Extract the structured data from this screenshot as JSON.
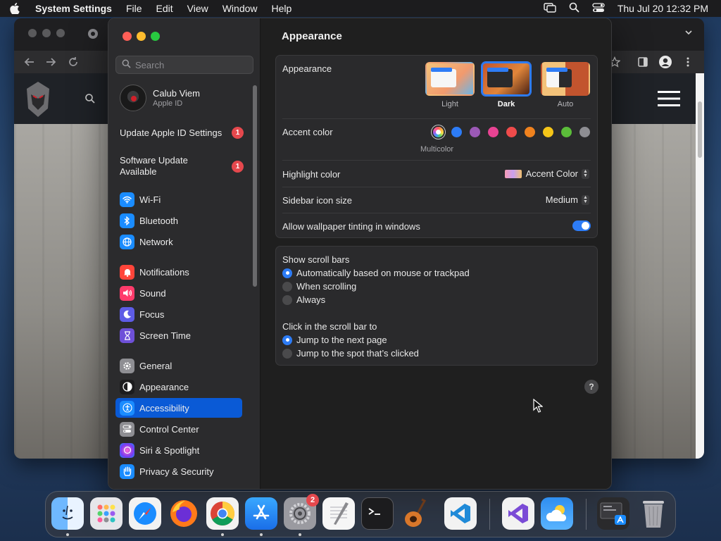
{
  "menubar": {
    "app_name": "System Settings",
    "menus": [
      "File",
      "Edit",
      "View",
      "Window",
      "Help"
    ],
    "clock": "Thu Jul 20  12:32 PM"
  },
  "sidebar": {
    "search_placeholder": "Search",
    "profile": {
      "name": "Calub Viem",
      "subtitle": "Apple ID"
    },
    "notices": [
      {
        "text": "Update Apple ID Settings",
        "badge": "1"
      },
      {
        "text": "Software Update Available",
        "badge": "1"
      }
    ],
    "groups": [
      [
        {
          "label": "Wi-Fi",
          "icon": "wifi-icon",
          "color": "#1a8cff"
        },
        {
          "label": "Bluetooth",
          "icon": "bluetooth-icon",
          "color": "#1a8cff"
        },
        {
          "label": "Network",
          "icon": "globe-icon",
          "color": "#1a8cff"
        }
      ],
      [
        {
          "label": "Notifications",
          "icon": "bell-icon",
          "color": "#ff453a"
        },
        {
          "label": "Sound",
          "icon": "speaker-icon",
          "color": "#ff3b6b"
        },
        {
          "label": "Focus",
          "icon": "moon-icon",
          "color": "#5e5ce6"
        },
        {
          "label": "Screen Time",
          "icon": "hourglass-icon",
          "color": "#6e50d8"
        }
      ],
      [
        {
          "label": "General",
          "icon": "gear-icon",
          "color": "#8e8e93"
        },
        {
          "label": "Appearance",
          "icon": "appearance-icon",
          "color": "#1c1c1e"
        },
        {
          "label": "Accessibility",
          "icon": "accessibility-icon",
          "color": "#1a8cff",
          "active": true
        },
        {
          "label": "Control Center",
          "icon": "control-center-icon",
          "color": "#8e8e93"
        },
        {
          "label": "Siri & Spotlight",
          "icon": "siri-icon",
          "color": "#7a3cf0"
        },
        {
          "label": "Privacy & Security",
          "icon": "hand-icon",
          "color": "#1a8cff"
        }
      ]
    ]
  },
  "main": {
    "title": "Appearance",
    "appearance": {
      "label": "Appearance",
      "options": [
        "Light",
        "Dark",
        "Auto"
      ],
      "selected": "Dark"
    },
    "accent": {
      "label": "Accent color",
      "caption": "Multicolor",
      "colors": [
        "#2d7cf6",
        "#9b59b6",
        "#e84393",
        "#ef4b4b",
        "#f0821e",
        "#f5c518",
        "#5bbd3a",
        "#8e8e93"
      ]
    },
    "highlight": {
      "label": "Highlight color",
      "value": "Accent Color"
    },
    "icon_size": {
      "label": "Sidebar icon size",
      "value": "Medium"
    },
    "tinting": {
      "label": "Allow wallpaper tinting in windows",
      "enabled": true
    },
    "scroll_bars": {
      "label": "Show scroll bars",
      "options": [
        "Automatically based on mouse or trackpad",
        "When scrolling",
        "Always"
      ],
      "selected": 0
    },
    "click_bar": {
      "label": "Click in the scroll bar to",
      "options": [
        "Jump to the next page",
        "Jump to the spot that’s clicked"
      ],
      "selected": 0
    },
    "help": "?"
  },
  "dock": {
    "apps": [
      "finder-icon",
      "launchpad-icon",
      "safari-icon",
      "firefox-icon",
      "chrome-icon",
      "app-store-icon",
      "system-settings-icon",
      "textedit-icon",
      "terminal-icon",
      "garageband-icon",
      "vscode-icon",
      "visual-studio-icon",
      "weather-icon",
      "downloads-stack-icon",
      "trash-icon"
    ],
    "settings_badge": "2"
  }
}
